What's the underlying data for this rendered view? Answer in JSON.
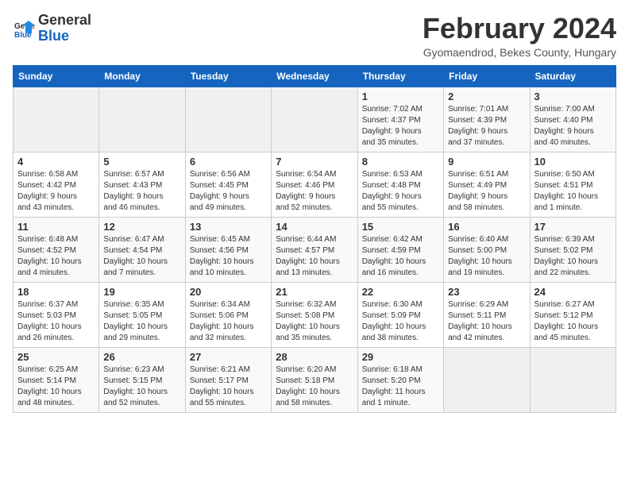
{
  "header": {
    "logo_line1": "General",
    "logo_line2": "Blue",
    "month_title": "February 2024",
    "subtitle": "Gyomaendrod, Bekes County, Hungary"
  },
  "weekdays": [
    "Sunday",
    "Monday",
    "Tuesday",
    "Wednesday",
    "Thursday",
    "Friday",
    "Saturday"
  ],
  "weeks": [
    [
      {
        "day": "",
        "info": ""
      },
      {
        "day": "",
        "info": ""
      },
      {
        "day": "",
        "info": ""
      },
      {
        "day": "",
        "info": ""
      },
      {
        "day": "1",
        "info": "Sunrise: 7:02 AM\nSunset: 4:37 PM\nDaylight: 9 hours\nand 35 minutes."
      },
      {
        "day": "2",
        "info": "Sunrise: 7:01 AM\nSunset: 4:39 PM\nDaylight: 9 hours\nand 37 minutes."
      },
      {
        "day": "3",
        "info": "Sunrise: 7:00 AM\nSunset: 4:40 PM\nDaylight: 9 hours\nand 40 minutes."
      }
    ],
    [
      {
        "day": "4",
        "info": "Sunrise: 6:58 AM\nSunset: 4:42 PM\nDaylight: 9 hours\nand 43 minutes."
      },
      {
        "day": "5",
        "info": "Sunrise: 6:57 AM\nSunset: 4:43 PM\nDaylight: 9 hours\nand 46 minutes."
      },
      {
        "day": "6",
        "info": "Sunrise: 6:56 AM\nSunset: 4:45 PM\nDaylight: 9 hours\nand 49 minutes."
      },
      {
        "day": "7",
        "info": "Sunrise: 6:54 AM\nSunset: 4:46 PM\nDaylight: 9 hours\nand 52 minutes."
      },
      {
        "day": "8",
        "info": "Sunrise: 6:53 AM\nSunset: 4:48 PM\nDaylight: 9 hours\nand 55 minutes."
      },
      {
        "day": "9",
        "info": "Sunrise: 6:51 AM\nSunset: 4:49 PM\nDaylight: 9 hours\nand 58 minutes."
      },
      {
        "day": "10",
        "info": "Sunrise: 6:50 AM\nSunset: 4:51 PM\nDaylight: 10 hours\nand 1 minute."
      }
    ],
    [
      {
        "day": "11",
        "info": "Sunrise: 6:48 AM\nSunset: 4:52 PM\nDaylight: 10 hours\nand 4 minutes."
      },
      {
        "day": "12",
        "info": "Sunrise: 6:47 AM\nSunset: 4:54 PM\nDaylight: 10 hours\nand 7 minutes."
      },
      {
        "day": "13",
        "info": "Sunrise: 6:45 AM\nSunset: 4:56 PM\nDaylight: 10 hours\nand 10 minutes."
      },
      {
        "day": "14",
        "info": "Sunrise: 6:44 AM\nSunset: 4:57 PM\nDaylight: 10 hours\nand 13 minutes."
      },
      {
        "day": "15",
        "info": "Sunrise: 6:42 AM\nSunset: 4:59 PM\nDaylight: 10 hours\nand 16 minutes."
      },
      {
        "day": "16",
        "info": "Sunrise: 6:40 AM\nSunset: 5:00 PM\nDaylight: 10 hours\nand 19 minutes."
      },
      {
        "day": "17",
        "info": "Sunrise: 6:39 AM\nSunset: 5:02 PM\nDaylight: 10 hours\nand 22 minutes."
      }
    ],
    [
      {
        "day": "18",
        "info": "Sunrise: 6:37 AM\nSunset: 5:03 PM\nDaylight: 10 hours\nand 26 minutes."
      },
      {
        "day": "19",
        "info": "Sunrise: 6:35 AM\nSunset: 5:05 PM\nDaylight: 10 hours\nand 29 minutes."
      },
      {
        "day": "20",
        "info": "Sunrise: 6:34 AM\nSunset: 5:06 PM\nDaylight: 10 hours\nand 32 minutes."
      },
      {
        "day": "21",
        "info": "Sunrise: 6:32 AM\nSunset: 5:08 PM\nDaylight: 10 hours\nand 35 minutes."
      },
      {
        "day": "22",
        "info": "Sunrise: 6:30 AM\nSunset: 5:09 PM\nDaylight: 10 hours\nand 38 minutes."
      },
      {
        "day": "23",
        "info": "Sunrise: 6:29 AM\nSunset: 5:11 PM\nDaylight: 10 hours\nand 42 minutes."
      },
      {
        "day": "24",
        "info": "Sunrise: 6:27 AM\nSunset: 5:12 PM\nDaylight: 10 hours\nand 45 minutes."
      }
    ],
    [
      {
        "day": "25",
        "info": "Sunrise: 6:25 AM\nSunset: 5:14 PM\nDaylight: 10 hours\nand 48 minutes."
      },
      {
        "day": "26",
        "info": "Sunrise: 6:23 AM\nSunset: 5:15 PM\nDaylight: 10 hours\nand 52 minutes."
      },
      {
        "day": "27",
        "info": "Sunrise: 6:21 AM\nSunset: 5:17 PM\nDaylight: 10 hours\nand 55 minutes."
      },
      {
        "day": "28",
        "info": "Sunrise: 6:20 AM\nSunset: 5:18 PM\nDaylight: 10 hours\nand 58 minutes."
      },
      {
        "day": "29",
        "info": "Sunrise: 6:18 AM\nSunset: 5:20 PM\nDaylight: 11 hours\nand 1 minute."
      },
      {
        "day": "",
        "info": ""
      },
      {
        "day": "",
        "info": ""
      }
    ]
  ]
}
